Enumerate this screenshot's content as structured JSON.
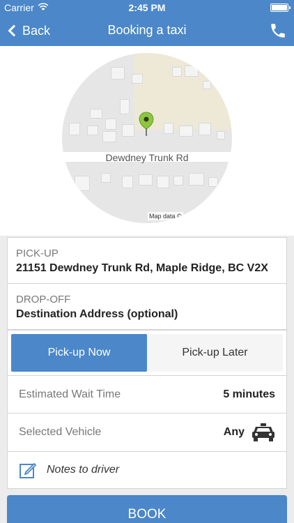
{
  "statusbar": {
    "carrier": "Carrier",
    "time": "2:45 PM"
  },
  "navbar": {
    "back_label": "Back",
    "title": "Booking a taxi"
  },
  "map": {
    "road_label": "Dewdney Trunk Rd",
    "attribution": "Map data ©"
  },
  "pickup": {
    "label": "PICK-UP",
    "value": "21151 Dewdney Trunk Rd, Maple Ridge, BC V2X"
  },
  "dropoff": {
    "label": "DROP-OFF",
    "value": "Destination Address (optional)"
  },
  "timing": {
    "now_label": "Pick-up Now",
    "later_label": "Pick-up Later",
    "selected": "Pick-up Now"
  },
  "wait": {
    "label": "Estimated Wait Time",
    "value": "5 minutes"
  },
  "vehicle": {
    "label": "Selected Vehicle",
    "value": "Any",
    "icon": "taxi-icon"
  },
  "notes": {
    "label": "Notes to driver",
    "icon": "edit-note-icon"
  },
  "book": {
    "label": "BOOK"
  },
  "colors": {
    "accent": "#4b87c9",
    "pin": "#8dc63f"
  }
}
